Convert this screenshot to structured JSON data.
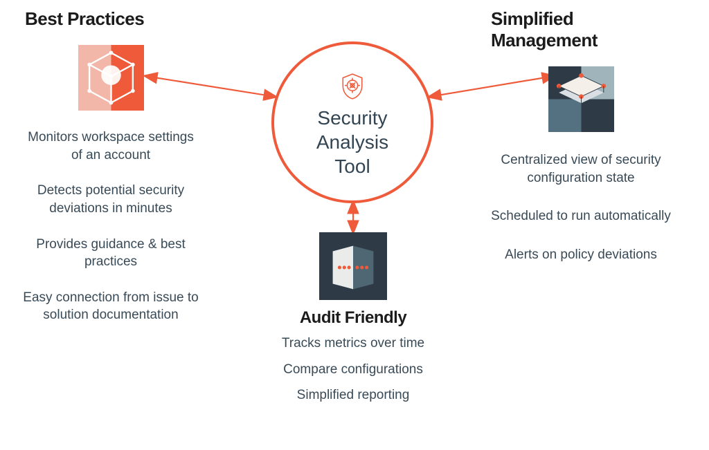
{
  "center": {
    "title_line1": "Security",
    "title_line2": "Analysis",
    "title_line3": "Tool"
  },
  "left": {
    "heading": "Best Practices",
    "bullets": [
      "Monitors workspace settings of an account",
      "Detects potential security deviations in minutes",
      "Provides guidance & best practices",
      "Easy connection from issue to solution documentation"
    ]
  },
  "right": {
    "heading": "Simplified Management",
    "bullets": [
      "Centralized view of security  configuration state",
      "Scheduled to run automatically",
      "Alerts on policy deviations"
    ]
  },
  "bottom": {
    "heading": "Audit Friendly",
    "bullets": [
      "Tracks metrics over time",
      "Compare configurations",
      "Simplified reporting"
    ]
  },
  "icons": {
    "left": "cube-icon",
    "right": "layer-icon",
    "bottom": "cards-icon",
    "center": "shield-icon"
  },
  "colors": {
    "accent": "#ef5a3a",
    "dark": "#2e3b47",
    "slate": "#4e6773"
  }
}
